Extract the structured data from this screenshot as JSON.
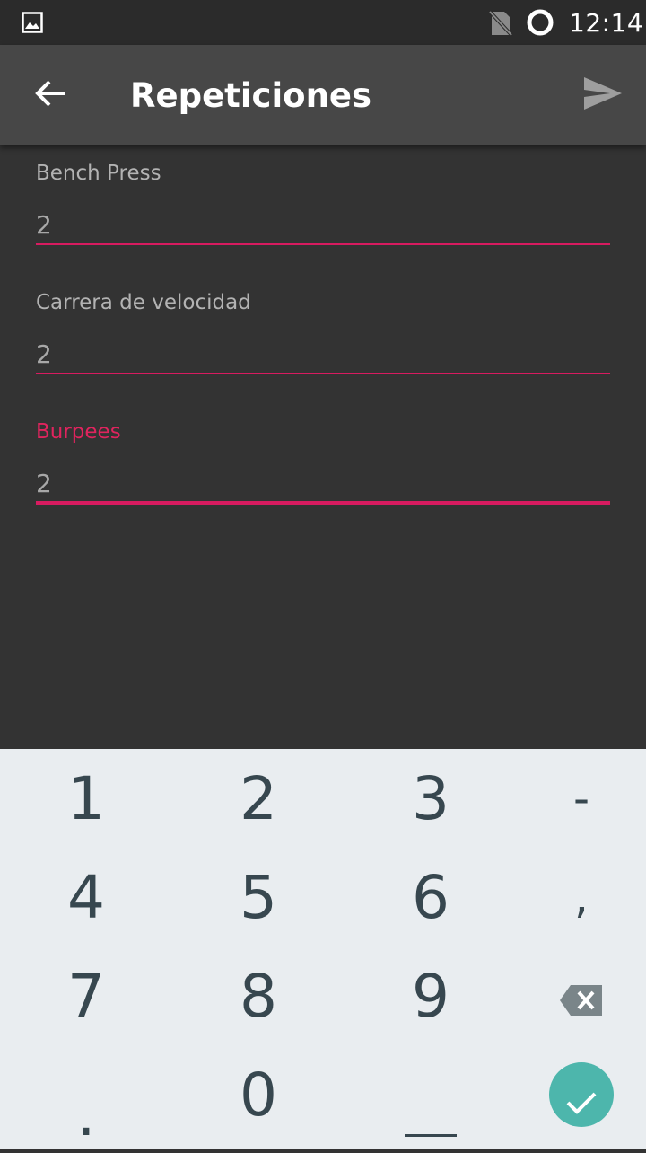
{
  "status_bar": {
    "time": "12:14",
    "icons": [
      "gallery-icon",
      "no-sim-icon",
      "battery-ring-icon"
    ]
  },
  "app_bar": {
    "title": "Repeticiones",
    "back_icon": "arrow-back-icon",
    "send_icon": "send-icon"
  },
  "form": {
    "fields": [
      {
        "label": "Bench Press",
        "value": "2",
        "focused": false
      },
      {
        "label": "Carrera de velocidad",
        "value": "2",
        "focused": false
      },
      {
        "label": "Burpees",
        "value": "2",
        "focused": true
      }
    ]
  },
  "keyboard": {
    "rows": [
      [
        "1",
        "2",
        "3",
        "-"
      ],
      [
        "4",
        "5",
        "6",
        ","
      ],
      [
        "7",
        "8",
        "9",
        "backspace"
      ],
      [
        ".",
        "0",
        "space",
        "done"
      ]
    ]
  },
  "colors": {
    "accent": "#e0245e",
    "underline": "#d81b60",
    "background": "#333333",
    "app_bar": "#474747",
    "keyboard": "#e9edf0",
    "key_text": "#37474f",
    "done_button": "#4db6ac"
  }
}
